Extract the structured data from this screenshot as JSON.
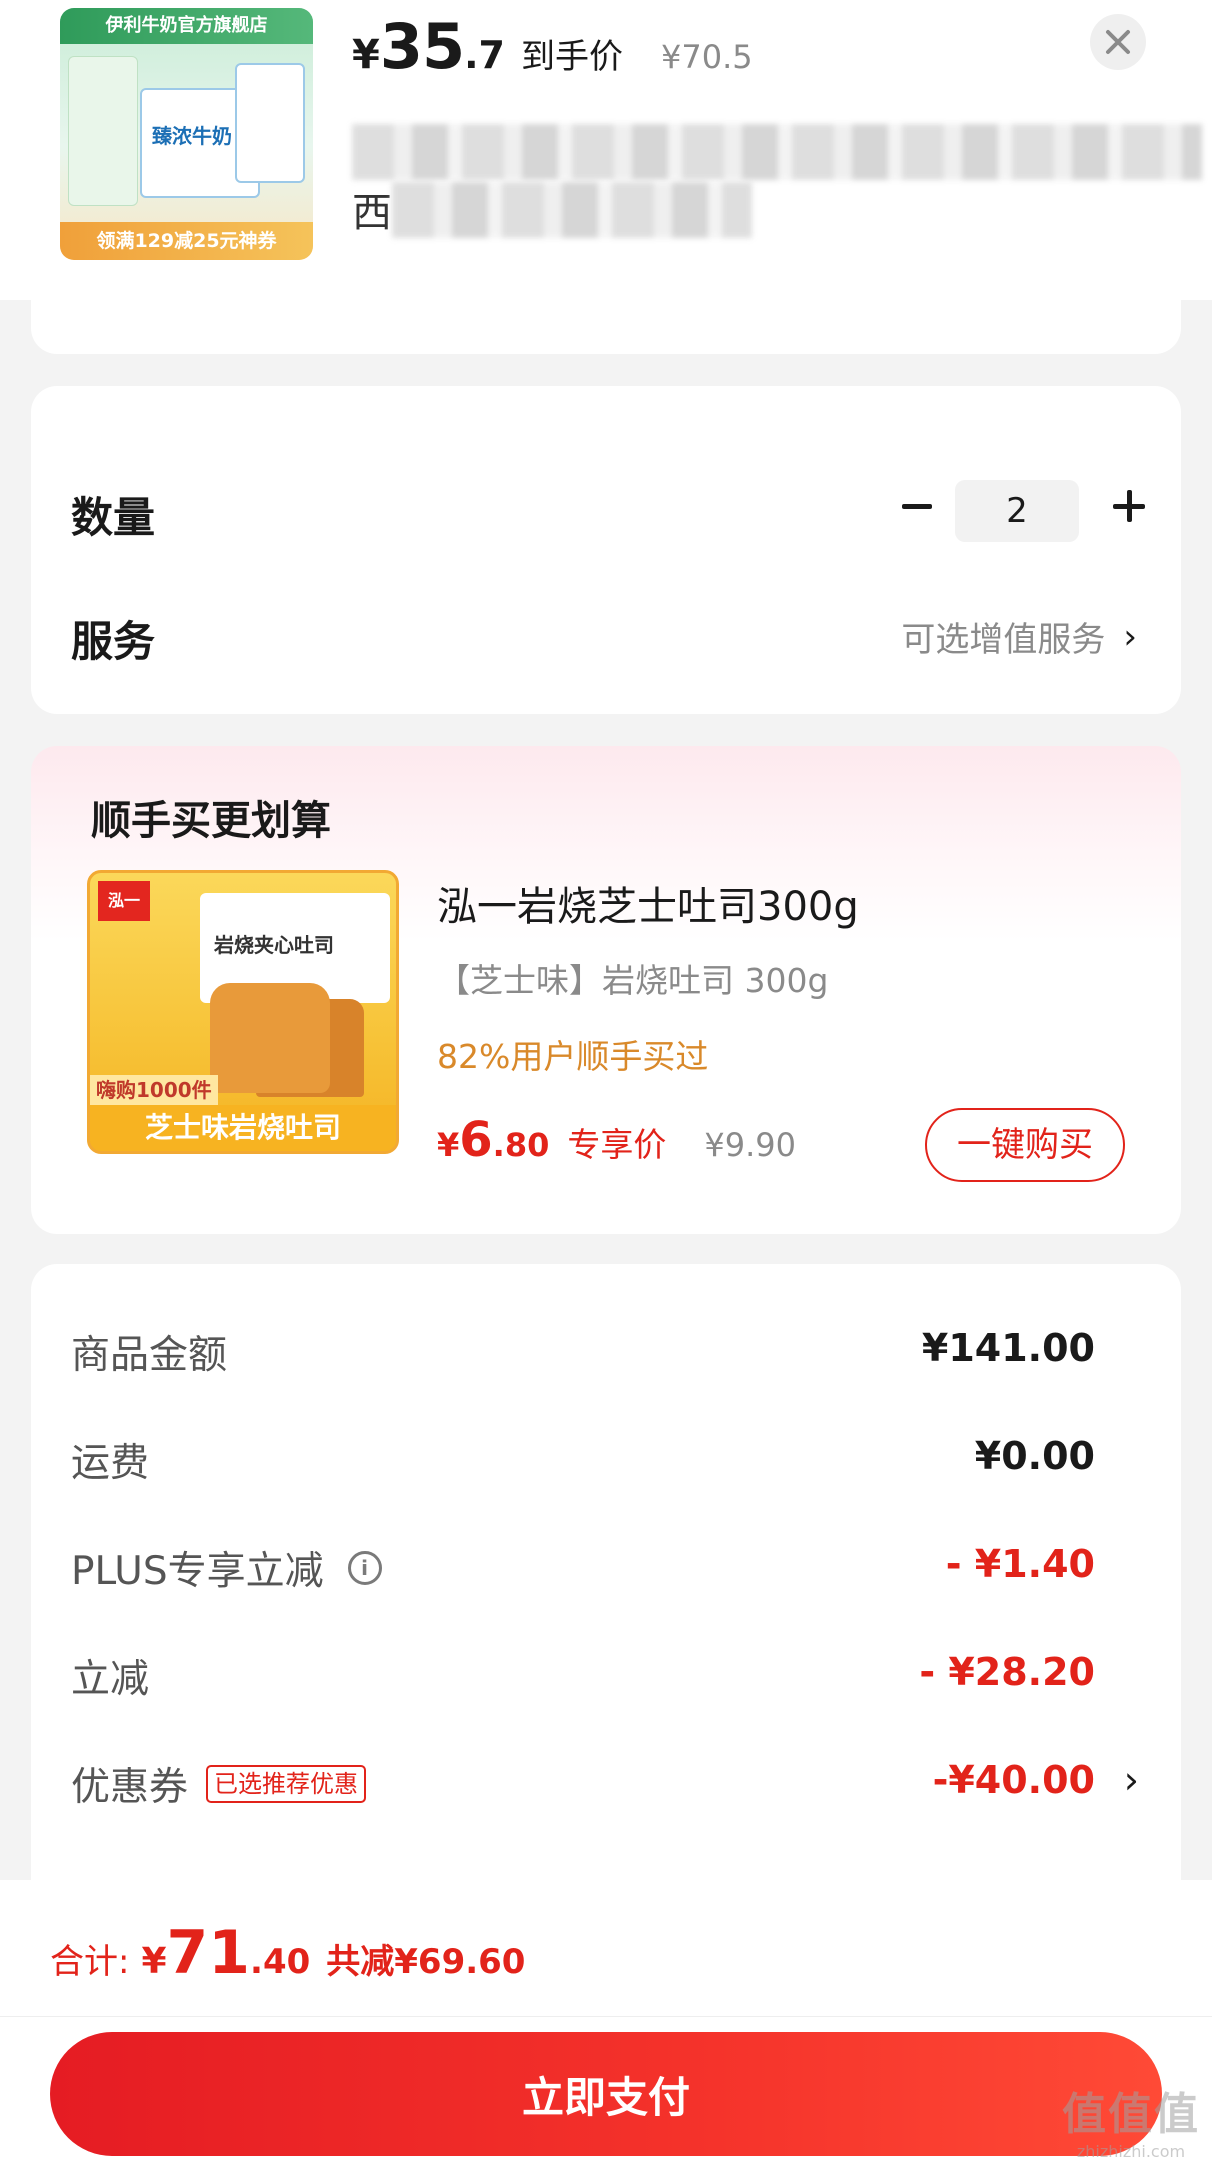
{
  "header": {
    "product_image": {
      "store": "伊利牛奶官方旗舰店",
      "brand_text": "臻浓牛奶",
      "coupon": "领满129减25元神券"
    },
    "price": {
      "currency": "¥",
      "integer": "35",
      "decimal": ".7",
      "label": "到手价",
      "original": "¥70.5"
    },
    "address_first_char": "西",
    "close_icon": "close-icon"
  },
  "quantity_section": {
    "quantity_label": "数量",
    "quantity_value": "2",
    "service_label": "服务",
    "service_value": "可选增值服务",
    "service_chevron": "›"
  },
  "bundle": {
    "title": "顺手买更划算",
    "image": {
      "logo": "泓一",
      "package_text": "岩烧夹心吐司",
      "promo": "嗨购1000件",
      "bottom_text": "芝士味岩烧吐司"
    },
    "product_name": "泓一岩烧芝士吐司300g",
    "spec": "【芝士味】岩烧吐司 300g",
    "social_proof": "82%用户顺手买过",
    "price": {
      "currency": "¥",
      "integer": "6",
      "decimal": ".80",
      "label": "专享价",
      "original": "¥9.90"
    },
    "buy_button": "一键购买"
  },
  "summary": {
    "rows": [
      {
        "label": "商品金额",
        "value": "¥141.00",
        "emphasis": "normal"
      },
      {
        "label": "运费",
        "value": "¥0.00",
        "emphasis": "normal"
      },
      {
        "label": "PLUS专享立减",
        "value": "- ¥1.40",
        "emphasis": "discount"
      },
      {
        "label": "立减",
        "value": "- ¥28.20",
        "emphasis": "discount"
      },
      {
        "label": "优惠券",
        "tag": "已选推荐优惠",
        "value": "-¥40.00",
        "emphasis": "discount"
      }
    ],
    "info_icon": "i"
  },
  "footer": {
    "total_label": "合计:",
    "total_currency": "¥",
    "total_integer": "71",
    "total_decimal": ".40",
    "total_saved": "共减¥69.60",
    "pay_button": "立即支付",
    "watermark": {
      "big": "值值值",
      "small": "zhizhizhi.com"
    }
  },
  "colors": {
    "accent": "#e2231a",
    "orange": "#d9892a",
    "background": "#f3f3f3"
  }
}
